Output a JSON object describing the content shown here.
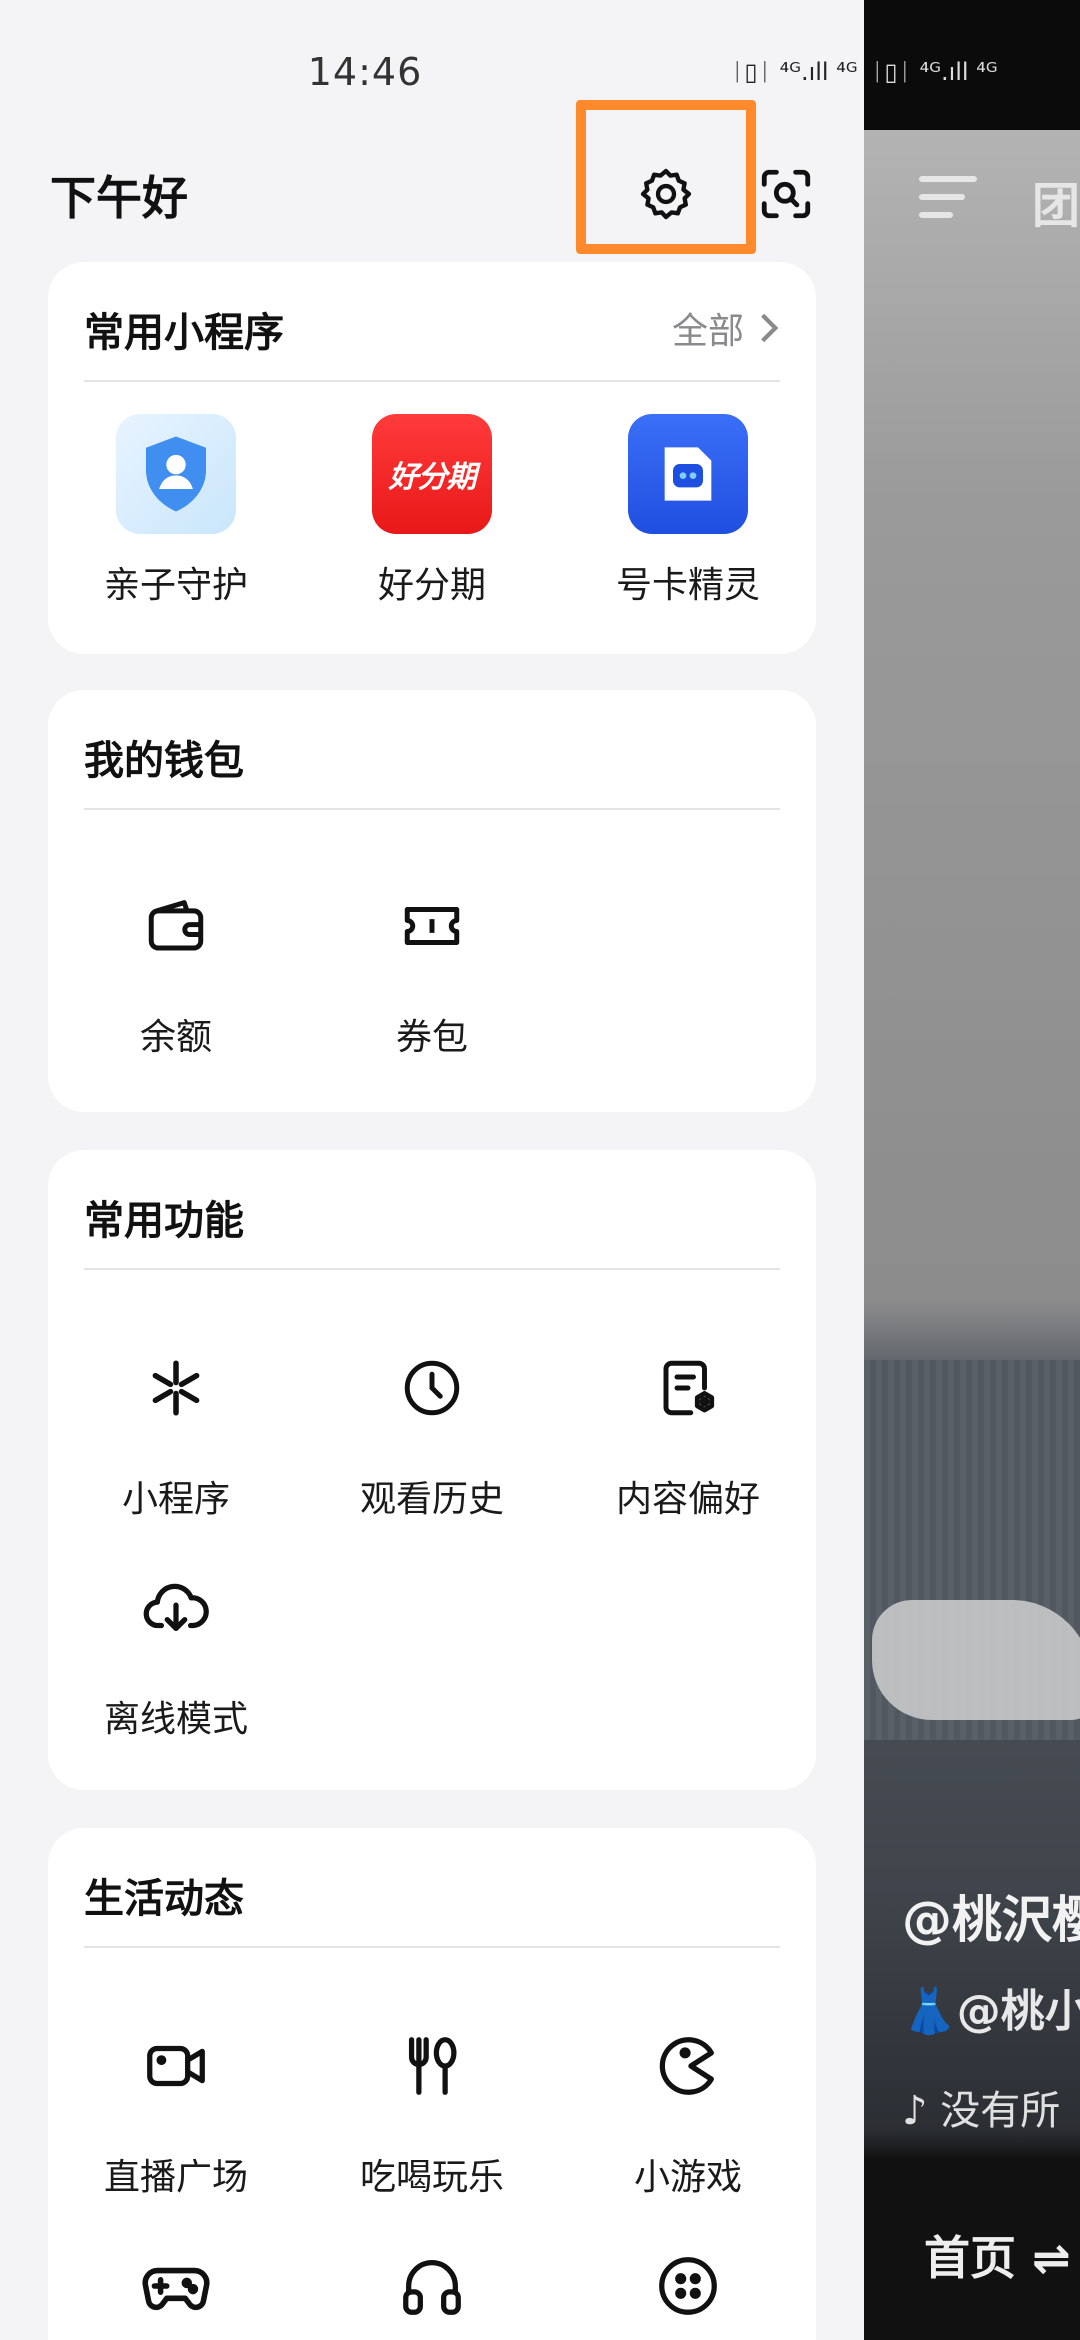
{
  "status": {
    "time": "14:46",
    "indicators": "ᛁ▯ᛁ ⁴ᴳ.ıll ⁴ᴳ"
  },
  "header": {
    "greeting": "下午好",
    "settings_icon": "gear-icon",
    "scan_icon": "scan-icon",
    "highlight_color": "#ff8a2b"
  },
  "mini_programs": {
    "title": "常用小程序",
    "link_label": "全部",
    "items": [
      {
        "label": "亲子守护",
        "icon": "shield-user-icon",
        "color": "#3f8ef0"
      },
      {
        "label": "好分期",
        "icon": "haofenqi-logo",
        "logo_text": "好分期",
        "color": "#f52a2a"
      },
      {
        "label": "号卡精灵",
        "icon": "sim-card-robot-icon",
        "color": "#2a5df0"
      }
    ]
  },
  "wallet": {
    "title": "我的钱包",
    "items": [
      {
        "label": "余额",
        "icon": "wallet-icon"
      },
      {
        "label": "券包",
        "icon": "coupon-icon"
      }
    ]
  },
  "functions": {
    "title": "常用功能",
    "items": [
      {
        "label": "小程序",
        "icon": "mini-program-icon"
      },
      {
        "label": "观看历史",
        "icon": "clock-icon"
      },
      {
        "label": "内容偏好",
        "icon": "content-preference-icon"
      },
      {
        "label": "离线模式",
        "icon": "cloud-download-icon"
      }
    ]
  },
  "life": {
    "title": "生活动态",
    "items": [
      {
        "label": "直播广场",
        "icon": "video-camera-icon"
      },
      {
        "label": "吃喝玩乐",
        "icon": "fork-spoon-icon"
      },
      {
        "label": "小游戏",
        "icon": "pacman-icon"
      },
      {
        "label": "",
        "icon": "gamepad-icon"
      },
      {
        "label": "",
        "icon": "headphones-icon"
      },
      {
        "label": "",
        "icon": "dice-icon"
      }
    ]
  },
  "video": {
    "top_tab": "团",
    "username": "@桃沢樱",
    "description": "👗@桃小",
    "music": "♪ 没有所",
    "nav_home": "首页 ⇌"
  }
}
